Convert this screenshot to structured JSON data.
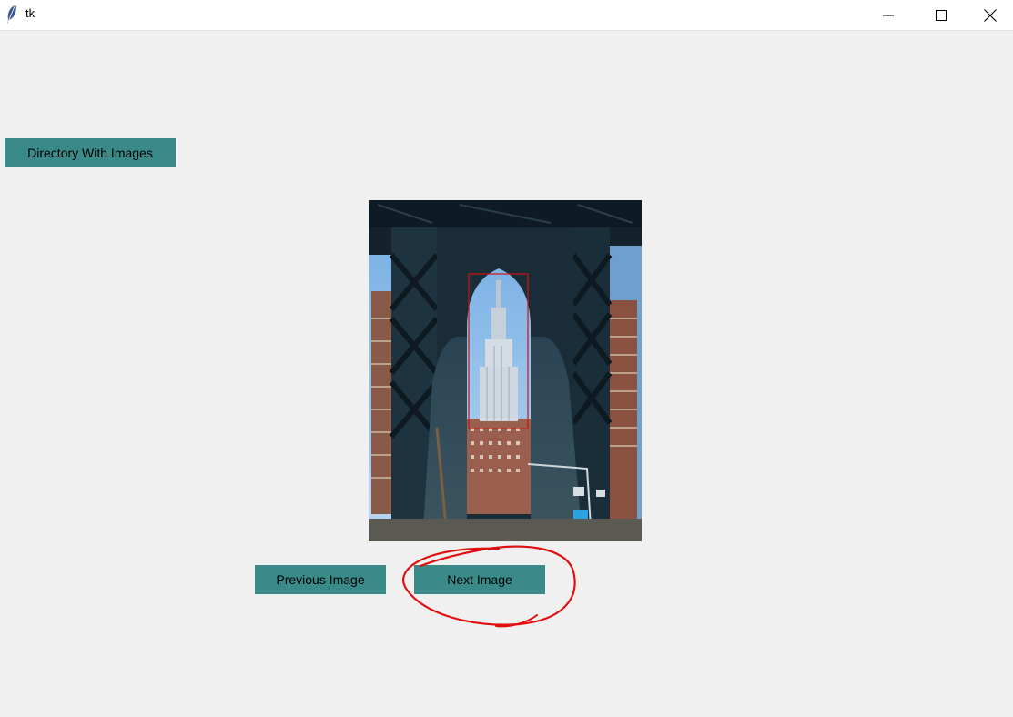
{
  "window": {
    "title": "tk",
    "controls": {
      "minimize_icon": "minimize-icon",
      "maximize_icon": "maximize-icon",
      "close_icon": "close-icon"
    }
  },
  "toolbar": {
    "directory_label": "Directory With Images"
  },
  "viewer": {
    "image_icon": "photo-empire-state-through-bridge",
    "detection_box_color": "#d01010"
  },
  "navigation": {
    "previous_label": "Previous Image",
    "next_label": "Next Image"
  },
  "annotation": {
    "highlight": "next-image-button",
    "color": "#e01010"
  },
  "colors": {
    "button_bg": "#3a8a8a",
    "window_bg": "#f0f0f0"
  }
}
